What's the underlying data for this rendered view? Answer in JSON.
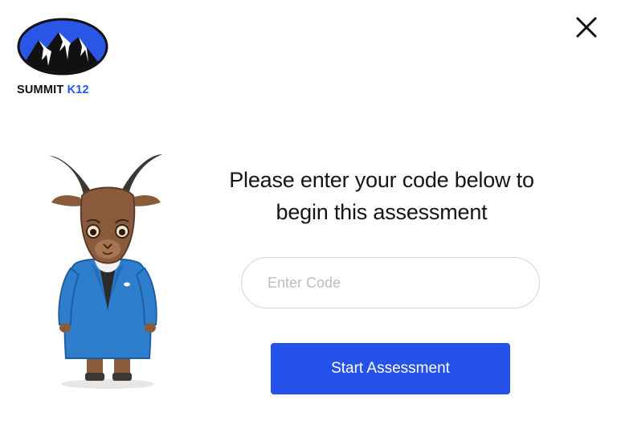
{
  "brand": {
    "name_part1": "SUMMIT",
    "name_part2": "K12",
    "logo_colors": {
      "sky": "#2a56e8",
      "outline": "#111111",
      "mountain": "#111111",
      "snow": "#ffffff"
    }
  },
  "header": {
    "close_icon": "close-icon"
  },
  "mascot": {
    "icon": "goat-mascot-illustration"
  },
  "main": {
    "prompt_line1": "Please enter your code below to",
    "prompt_line2": "begin this assessment",
    "code_input": {
      "value": "",
      "placeholder": "Enter Code"
    },
    "start_button_label": "Start Assessment"
  },
  "colors": {
    "primary_button": "#2553ea",
    "input_border": "#d4d4d4",
    "text": "#151515"
  }
}
